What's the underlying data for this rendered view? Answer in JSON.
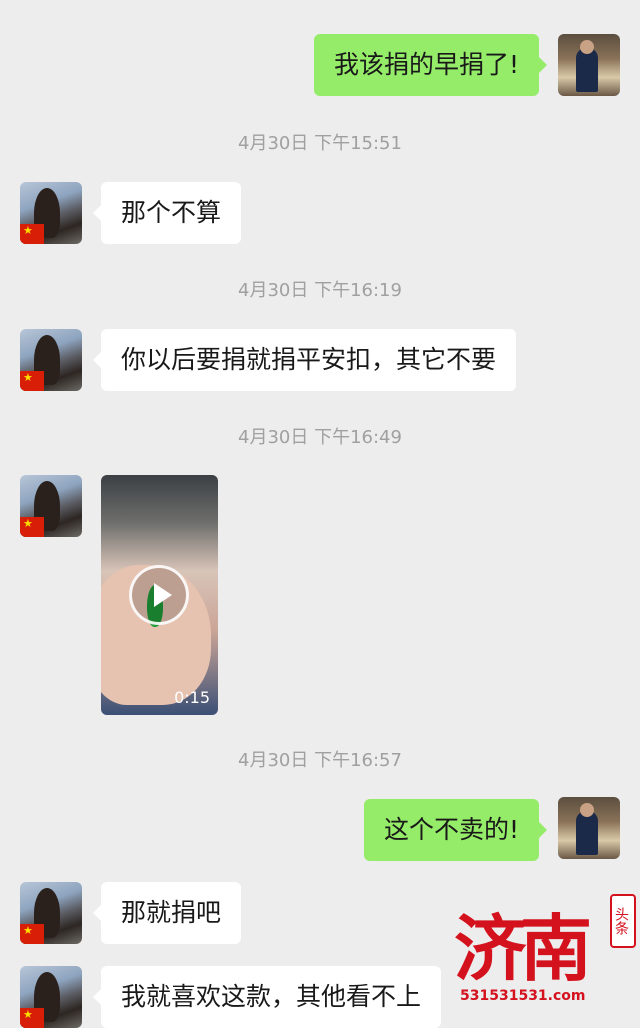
{
  "messages": [
    {
      "side": "right",
      "text": "我该捐的早捐了!"
    },
    {
      "timestamp": "4月30日 下午15:51"
    },
    {
      "side": "left",
      "text": "那个不算"
    },
    {
      "timestamp": "4月30日 下午16:19"
    },
    {
      "side": "left",
      "text": "你以后要捐就捐平安扣，其它不要"
    },
    {
      "timestamp": "4月30日 下午16:49"
    },
    {
      "side": "left",
      "type": "video",
      "duration": "0:15"
    },
    {
      "timestamp": "4月30日 下午16:57"
    },
    {
      "side": "right",
      "text": "这个不卖的!"
    },
    {
      "side": "left",
      "text": "那就捐吧"
    },
    {
      "side": "left",
      "text": "我就喜欢这款，其他看不上"
    }
  ],
  "watermark": {
    "brand": "济南",
    "badge": "头条",
    "url": "531531531.com"
  },
  "colors": {
    "background": "#ededed",
    "bubble_self": "#95ec69",
    "bubble_other": "#ffffff",
    "timestamp": "#a0a0a0",
    "watermark": "#d4121e"
  },
  "icons": [
    "play-icon",
    "flag-icon"
  ]
}
